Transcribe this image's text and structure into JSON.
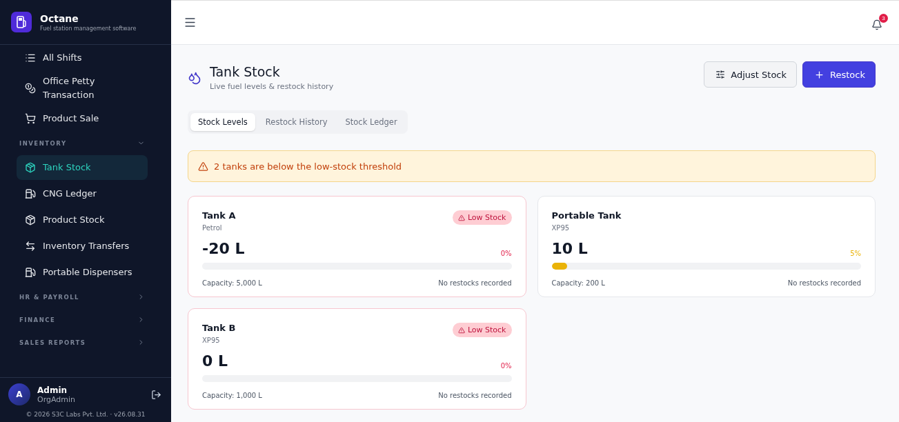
{
  "brand": {
    "name": "Octane",
    "tagline": "Fuel station management software"
  },
  "sidebar": {
    "items": [
      {
        "kind": "item",
        "label": "All Shifts",
        "selected": false
      },
      {
        "kind": "item",
        "label": "Office Petty Transaction",
        "selected": false
      },
      {
        "kind": "item",
        "label": "Product Sale",
        "selected": false
      },
      {
        "kind": "section",
        "label": "INVENTORY",
        "expanded": true
      },
      {
        "kind": "item",
        "label": "Tank Stock",
        "selected": true
      },
      {
        "kind": "item",
        "label": "CNG Ledger",
        "selected": false
      },
      {
        "kind": "item",
        "label": "Product Stock",
        "selected": false
      },
      {
        "kind": "item",
        "label": "Inventory Transfers",
        "selected": false
      },
      {
        "kind": "item",
        "label": "Portable Dispensers",
        "selected": false
      },
      {
        "kind": "section",
        "label": "HR & PAYROLL",
        "expanded": false
      },
      {
        "kind": "section",
        "label": "FINANCE",
        "expanded": false
      },
      {
        "kind": "section",
        "label": "SALES REPORTS",
        "expanded": false
      }
    ]
  },
  "user": {
    "initial": "A",
    "name": "Admin",
    "role": "OrgAdmin"
  },
  "footer": "© 2026 S3C Labs Pvt. Ltd. · v26.08.31",
  "notifications": {
    "count": "3"
  },
  "page": {
    "title": "Tank Stock",
    "subtitle": "Live fuel levels & restock history"
  },
  "actions": [
    {
      "kind": "secondary",
      "label": "Adjust Stock"
    },
    {
      "kind": "primary",
      "label": "Restock"
    }
  ],
  "tabs": [
    {
      "label": "Stock Levels",
      "selected": true
    },
    {
      "label": "Restock History",
      "selected": false
    },
    {
      "label": "Stock Ledger",
      "selected": false
    }
  ],
  "alert": "2 tanks are below the low-stock threshold",
  "tanks": [
    {
      "name": "Tank A",
      "fuel": "Petrol",
      "low_stock": true,
      "badge": "Low Stock",
      "amount": "-20 L",
      "percent": "0%",
      "level": 0,
      "capacity": "Capacity: 5,000 L",
      "restock": "No restocks recorded"
    },
    {
      "name": "Portable Tank",
      "fuel": "XP95",
      "low_stock": false,
      "amount": "10 L",
      "percent": "5%",
      "level": 0.05,
      "capacity": "Capacity: 200 L",
      "restock": "No restocks recorded"
    },
    {
      "name": "Tank B",
      "fuel": "XP95",
      "low_stock": true,
      "badge": "Low Stock",
      "amount": "0 L",
      "percent": "0%",
      "level": 0,
      "capacity": "Capacity: 1,000 L",
      "restock": "No restocks recorded"
    }
  ]
}
